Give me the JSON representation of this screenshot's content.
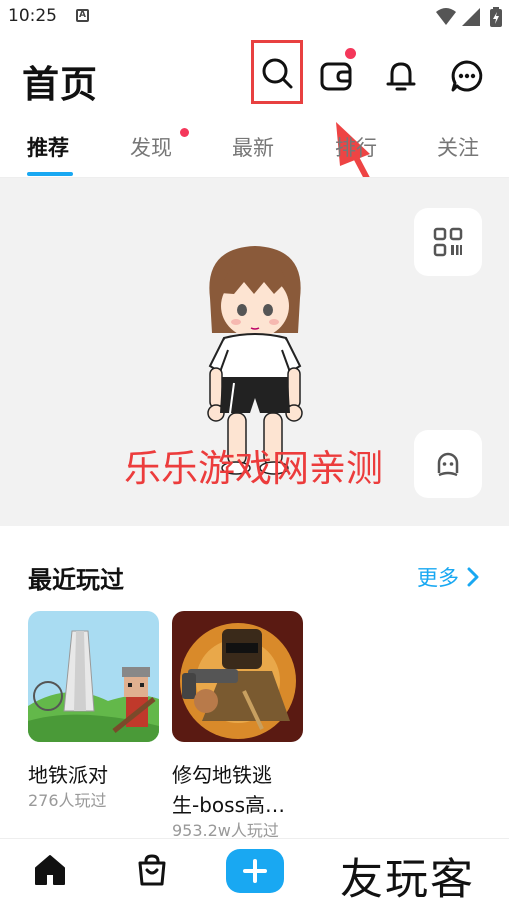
{
  "status_bar": {
    "time": "10:25",
    "icons": [
      "a-icon",
      "wifi-icon",
      "signal-icon",
      "battery-icon"
    ]
  },
  "header": {
    "title": "首页",
    "icons": [
      "search-icon",
      "wallet-icon",
      "bell-icon",
      "chat-icon"
    ]
  },
  "tabs": [
    {
      "label": "推荐",
      "active": true
    },
    {
      "label": "发现",
      "badge": true
    },
    {
      "label": "最新"
    },
    {
      "label": "排行"
    },
    {
      "label": "关注"
    }
  ],
  "hero": {
    "watermark": "乐乐游戏网亲测",
    "side_buttons": [
      "qr-code-icon",
      "avatar-face-icon"
    ]
  },
  "recent": {
    "title": "最近玩过",
    "more": "更多",
    "games": [
      {
        "name": "地铁派对",
        "plays": "276人玩过"
      },
      {
        "name": "修勾地铁逃生-boss高…",
        "name_line1": "修勾地铁逃",
        "name_line2": "生-boss高…",
        "plays": "953.2w人玩过"
      }
    ]
  },
  "bottom_nav": {
    "items": [
      "home-icon",
      "store-icon",
      "plus-icon"
    ],
    "brand": "友玩客"
  },
  "colors": {
    "accent": "#19a8f2",
    "badge": "#f4375a",
    "annotation": "#e84040"
  }
}
